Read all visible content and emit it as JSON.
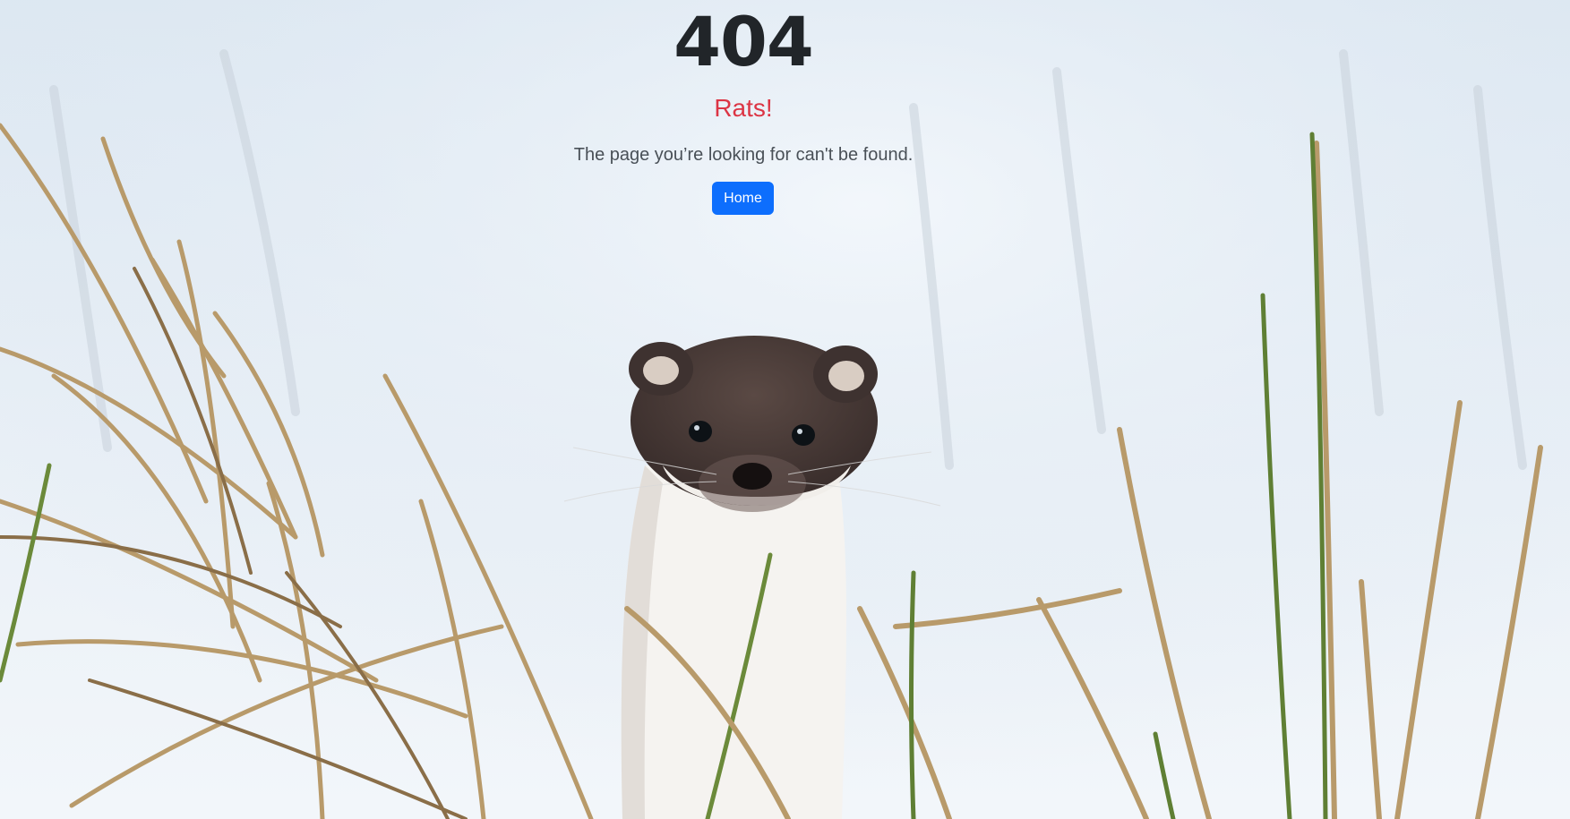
{
  "error": {
    "code": "404",
    "title": "Rats!",
    "message": "The page you’re looking for can't be found.",
    "home_button_label": "Home"
  },
  "colors": {
    "code_text": "#212529",
    "title_text": "#dc3545",
    "message_text": "#495057",
    "button_bg": "#0d6efd",
    "button_text": "#ffffff",
    "snow": "#e6eef6",
    "grass_dry": "#b89a6a",
    "grass_green": "#6b8a3a",
    "stoat_fur": "#4a3b38",
    "stoat_white": "#f4f2ef"
  },
  "background": {
    "icon": "stoat-in-snowy-grass-photo"
  }
}
